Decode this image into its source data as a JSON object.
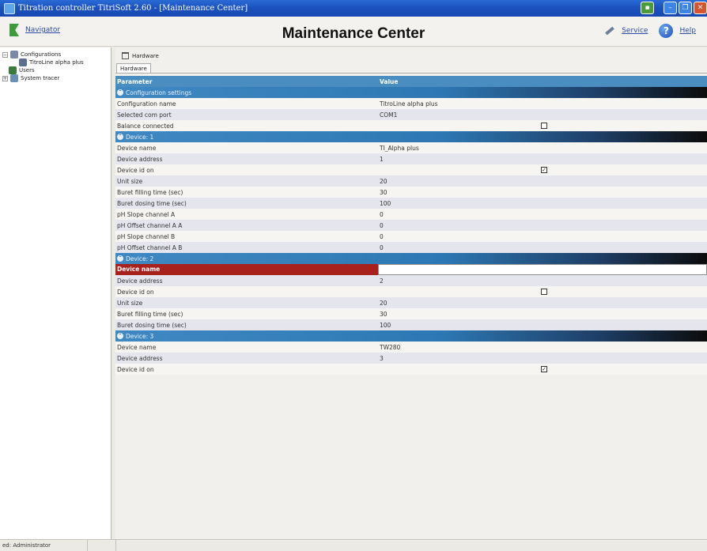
{
  "window": {
    "title": "Titration controller TitriSoft 2.60 - [Maintenance Center]"
  },
  "header": {
    "navigator_label": "Navigator",
    "page_title": "Maintenance Center",
    "service_label": "Service",
    "help_label": "Help"
  },
  "sidebar": {
    "items": [
      {
        "label": "Configurations",
        "icon": "configurations-icon",
        "expanded": true
      },
      {
        "label": "TitroLine alpha plus",
        "icon": "device-icon"
      },
      {
        "label": "Users",
        "icon": "users-icon"
      },
      {
        "label": "System tracer",
        "icon": "tracer-icon",
        "expanded": false
      }
    ]
  },
  "breadcrumb": {
    "label": "Hardware",
    "icon": "home-icon"
  },
  "tabs": [
    {
      "label": "Hardware",
      "active": true
    }
  ],
  "grid": {
    "columns": [
      "Parameter",
      "Value"
    ],
    "sections": [
      {
        "title": "Configuration settings",
        "rows": [
          {
            "name": "Configuration name",
            "value": "TitroLine alpha plus"
          },
          {
            "name": "Selected com port",
            "value": "COM1"
          },
          {
            "name": "Balance connected",
            "value": "",
            "checkbox": false
          }
        ]
      },
      {
        "title": "Device: 1",
        "rows": [
          {
            "name": "Device name",
            "value": "TI_Alpha plus"
          },
          {
            "name": "Device address",
            "value": "1"
          },
          {
            "name": "Device id on",
            "value": "",
            "checkbox": true
          },
          {
            "name": "Unit size",
            "value": "20"
          },
          {
            "name": "Buret filling time (sec)",
            "value": "30"
          },
          {
            "name": "Buret dosing time (sec)",
            "value": "100"
          },
          {
            "name": "pH Slope channel A",
            "value": "0"
          },
          {
            "name": "pH Offset channel A A",
            "value": "0"
          },
          {
            "name": "pH Slope channel B",
            "value": "0"
          },
          {
            "name": "pH Offset channel A B",
            "value": "0"
          }
        ]
      },
      {
        "title": "Device: 2",
        "rows": [
          {
            "name": "Device name",
            "value": "",
            "selected": true
          },
          {
            "name": "Device address",
            "value": "2"
          },
          {
            "name": "Device id on",
            "value": "",
            "checkbox": false
          },
          {
            "name": "Unit size",
            "value": "20"
          },
          {
            "name": "Buret filling time (sec)",
            "value": "30"
          },
          {
            "name": "Buret dosing time (sec)",
            "value": "100"
          }
        ]
      },
      {
        "title": "Device: 3",
        "rows": [
          {
            "name": "Device name",
            "value": "TW280"
          },
          {
            "name": "Device address",
            "value": "3"
          },
          {
            "name": "Device id on",
            "value": "",
            "checkbox": true
          }
        ]
      }
    ]
  },
  "statusbar": {
    "user_text": "ed: Administrator"
  },
  "colors": {
    "titlebar": "#1c52c0",
    "section_header": "#2d78b4",
    "selected_row": "#a8211d",
    "grid_header": "#4a8dc0"
  }
}
